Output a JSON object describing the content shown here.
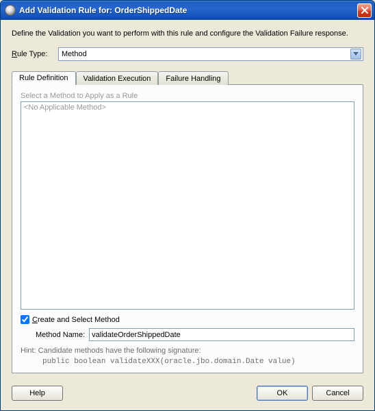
{
  "titlebar": {
    "text": "Add Validation Rule for: OrderShippedDate"
  },
  "description": "Define the Validation you want to perform with this rule and configure the Validation Failure response.",
  "ruleType": {
    "label_prefix": "R",
    "label_rest": "ule Type:",
    "value": "Method"
  },
  "tabs": {
    "ruleDefinition": "Rule Definition",
    "validationExecution": "Validation Execution",
    "failureHandling": "Failure Handling"
  },
  "panel": {
    "selectMethodLabel": "Select a Method to Apply as a Rule",
    "listPlaceholder": "<No Applicable Method>",
    "createCheckbox_underline": "C",
    "createCheckbox_rest": "reate and Select Method",
    "createCheckbox_checked": true,
    "methodNameLabel": "Method Name:",
    "methodNameValue": "validateOrderShippedDate",
    "hintLine1": "Hint: Candidate methods have the following signature:",
    "hintLine2": "public boolean validateXXX(oracle.jbo.domain.Date value)"
  },
  "buttons": {
    "help": "Help",
    "ok": "OK",
    "cancel": "Cancel"
  }
}
